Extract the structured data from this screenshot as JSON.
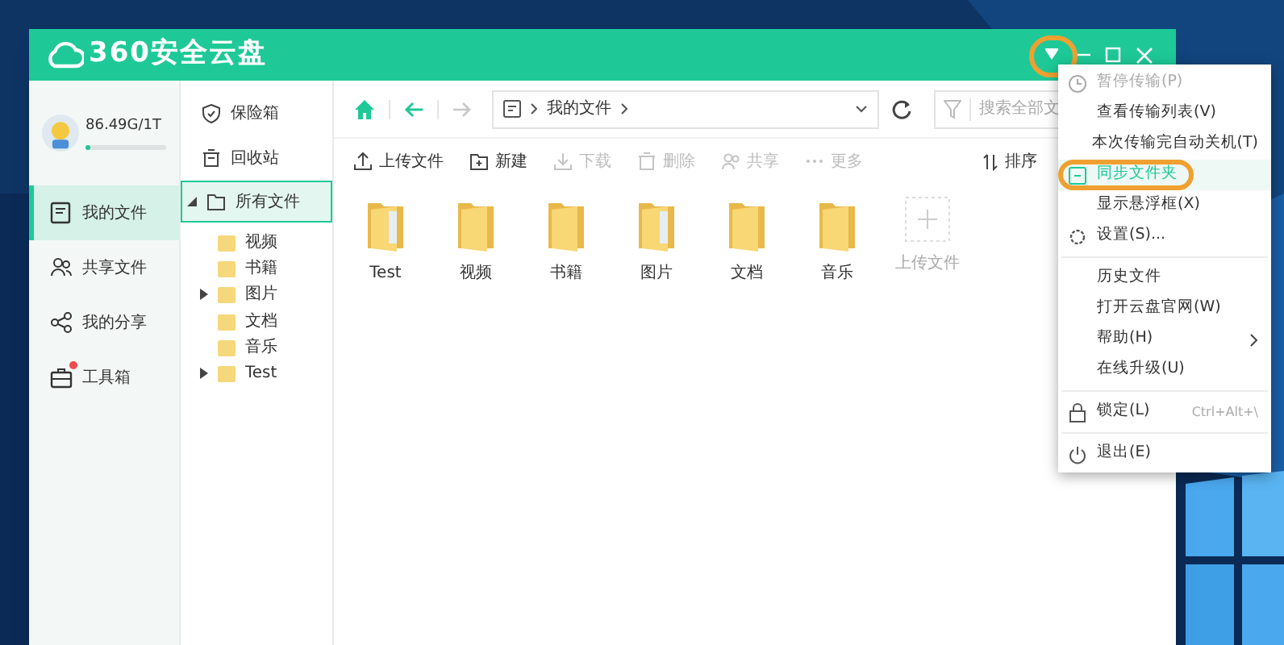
{
  "window": {
    "logo": "360安全云盘",
    "menu_button_circled": true
  },
  "account": {
    "storage": "86.49G/1T",
    "level": 0.06
  },
  "nav": [
    {
      "label": "我的文件",
      "kind": "files",
      "selected": true,
      "badge": false
    },
    {
      "label": "共享文件",
      "kind": "people",
      "selected": false,
      "badge": false
    },
    {
      "label": "我的分享",
      "kind": "share",
      "selected": false,
      "badge": false
    },
    {
      "label": "工具箱",
      "kind": "toolbox",
      "selected": false,
      "badge": true
    }
  ],
  "tree": [
    {
      "label": "保险箱",
      "kind": "safe",
      "selected": false
    },
    {
      "label": "回收站",
      "kind": "bin",
      "selected": false
    },
    {
      "label": "所有文件",
      "kind": "root",
      "selected": true,
      "expanded": true,
      "children": [
        {
          "label": "视频"
        },
        {
          "label": "书籍"
        },
        {
          "label": "图片",
          "expanded": false
        },
        {
          "label": "文档"
        },
        {
          "label": "音乐"
        },
        {
          "label": "Test",
          "expanded": false
        }
      ]
    }
  ],
  "address": {
    "path": [
      "我的文件"
    ]
  },
  "search": {
    "placeholder": "搜索全部文"
  },
  "actions": [
    {
      "label": "上传文件",
      "kind": "upload",
      "disabled": false
    },
    {
      "label": "新建",
      "kind": "new",
      "disabled": false
    },
    {
      "label": "下载",
      "kind": "download",
      "disabled": true
    },
    {
      "label": "删除",
      "kind": "delete",
      "disabled": true
    },
    {
      "label": "共享",
      "kind": "share",
      "disabled": true
    },
    {
      "label": "更多",
      "kind": "more",
      "disabled": true
    }
  ],
  "sort": {
    "label": "排序"
  },
  "files": [
    {
      "name": "Test",
      "kind": "folder-doc"
    },
    {
      "name": "视频",
      "kind": "folder"
    },
    {
      "name": "书籍",
      "kind": "folder"
    },
    {
      "name": "图片",
      "kind": "folder-doc"
    },
    {
      "name": "文档",
      "kind": "folder"
    },
    {
      "name": "音乐",
      "kind": "folder"
    },
    {
      "name": "上传文件",
      "kind": "upload"
    }
  ],
  "menu": [
    {
      "kind": "pause",
      "label": "暂停传输(P)",
      "disabled": true,
      "selected": false
    },
    {
      "kind": "item",
      "label": "查看传输列表(V)",
      "disabled": false,
      "selected": false
    },
    {
      "kind": "item",
      "label": "本次传输完自动关机(T)",
      "disabled": false,
      "selected": false
    },
    {
      "kind": "sync",
      "label": "同步文件夹",
      "disabled": false,
      "selected": true,
      "circled": true
    },
    {
      "kind": "item",
      "label": "显示悬浮框(X)",
      "disabled": false,
      "selected": false
    },
    {
      "kind": "gear",
      "label": "设置(S)...",
      "disabled": false,
      "selected": false
    },
    {
      "kind": "separator"
    },
    {
      "kind": "item",
      "label": "历史文件",
      "disabled": false,
      "selected": false
    },
    {
      "kind": "item",
      "label": "打开云盘官网(W)",
      "disabled": false,
      "selected": false
    },
    {
      "kind": "item",
      "label": "帮助(H)",
      "submenu": true,
      "disabled": false,
      "selected": false
    },
    {
      "kind": "item",
      "label": "在线升级(U)",
      "disabled": false,
      "selected": false
    },
    {
      "kind": "separator"
    },
    {
      "kind": "lock",
      "label": "锁定(L)",
      "shortcut": "Ctrl+Alt+\\",
      "disabled": false,
      "selected": false
    },
    {
      "kind": "separator"
    },
    {
      "kind": "power",
      "label": "退出(E)",
      "disabled": false,
      "selected": false
    }
  ]
}
